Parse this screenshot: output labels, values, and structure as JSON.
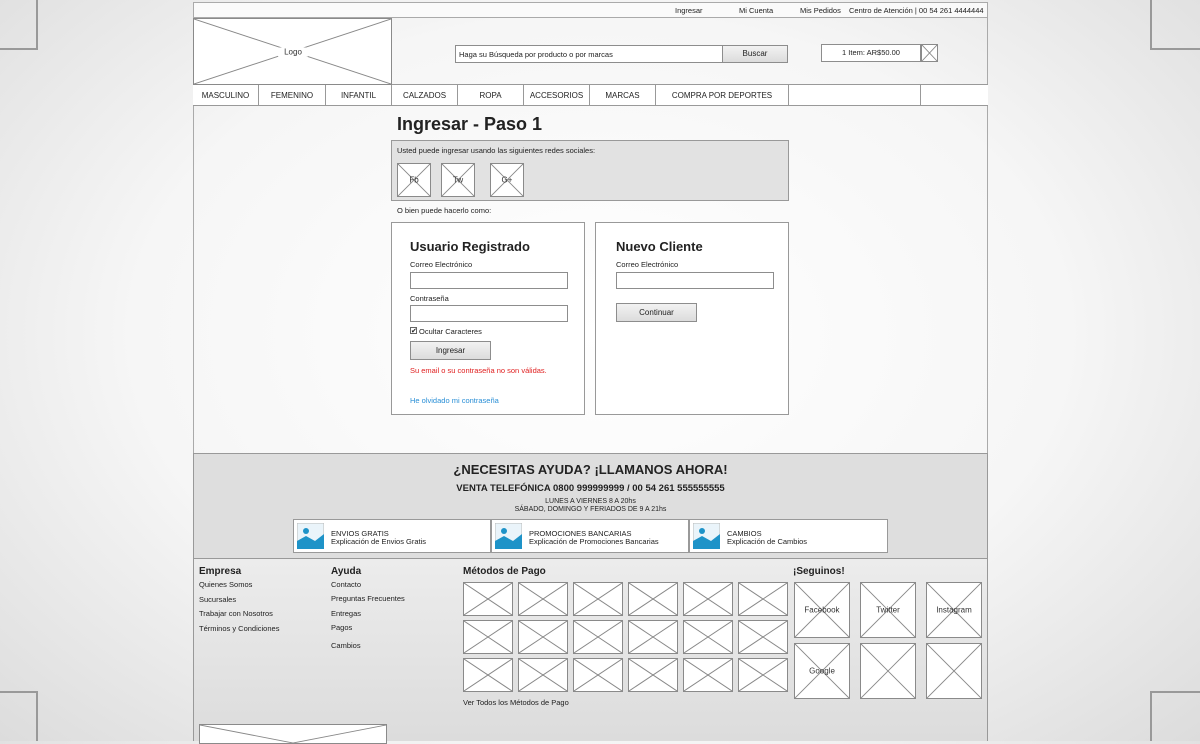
{
  "topbar": {
    "links": [
      "Ingresar",
      "Mi Cuenta",
      "Mis Pedidos"
    ],
    "contact": "Centro de Atención | 00 54 261 4444444"
  },
  "header": {
    "logo_label": "Logo",
    "search_placeholder": "Haga su Búsqueda por producto o por marcas",
    "search_button": "Buscar",
    "cart_text": "1 Item: AR$50.00"
  },
  "nav": [
    "MASCULINO",
    "FEMENINO",
    "INFANTIL",
    "CALZADOS",
    "ROPA",
    "ACCESORIOS",
    "MARCAS",
    "COMPRA POR DEPORTES"
  ],
  "login": {
    "title": "Ingresar - Paso 1",
    "social_intro": "Usted puede ingresar usando las siguientes redes sociales:",
    "social_buttons": [
      "Fb",
      "Tw",
      "G+"
    ],
    "or_text": "O bien puede hacerlo como:",
    "registered": {
      "heading": "Usuario Registrado",
      "email_label": "Correo Electrónico",
      "password_label": "Contraseña",
      "hide_chars": "Ocultar Caracteres",
      "submit": "Ingresar",
      "error": "Su email o su contraseña no son válidas.",
      "forgot": "He olvidado mi contraseña"
    },
    "new_client": {
      "heading": "Nuevo Cliente",
      "email_label": "Correo Electrónico",
      "continue": "Continuar"
    }
  },
  "help": {
    "title": "¿NECESITAS AYUDA? ¡LLAMANOS AHORA!",
    "phone": "VENTA TELEFÓNICA 0800 999999999 / 00 54 261 555555555",
    "hours1": "LUNES A VIERNES 8 A 20hs",
    "hours2": "SÁBADO, DOMINGO Y FERIADOS DE 9 A 21hs",
    "features": [
      {
        "title": "ENVIOS GRATIS",
        "desc": "Explicación de Envios Gratis"
      },
      {
        "title": "PROMOCIONES BANCARIAS",
        "desc": "Explicación de Promociones Bancarias"
      },
      {
        "title": "CAMBIOS",
        "desc": "Explicación de Cambios"
      }
    ]
  },
  "footer": {
    "empresa": {
      "heading": "Empresa",
      "links": [
        "Quienes Somos",
        "Sucursales",
        "Trabajar con Nosotros",
        "Términos y Condiciones"
      ]
    },
    "ayuda": {
      "heading": "Ayuda",
      "links": [
        "Contacto",
        "Preguntas Frecuentes",
        "Entregas",
        "Pagos",
        "Cambios"
      ]
    },
    "pagos": {
      "heading": "Métodos de Pago",
      "see_all": "Ver Todos los Métodos de Pago"
    },
    "seguinos": {
      "heading": "¡Seguinos!",
      "items": [
        "Facebook",
        "Twitter",
        "Instagram",
        "Google",
        "",
        ""
      ]
    }
  },
  "colors": {
    "error": "#e02020",
    "link": "#2a8fd6",
    "feature_icon": "#1e93c8"
  }
}
